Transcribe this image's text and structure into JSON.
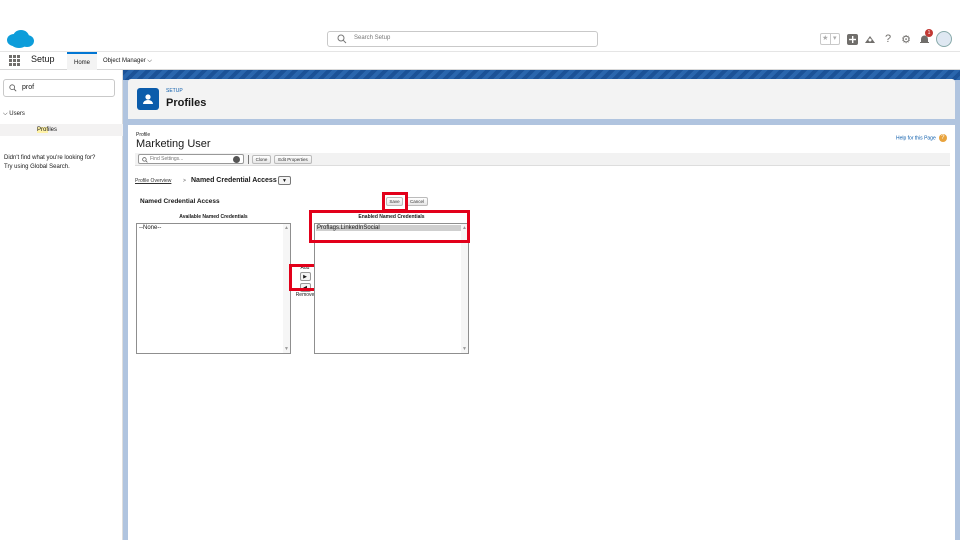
{
  "header": {
    "search_placeholder": "Search Setup",
    "notification_count": "1",
    "icons": [
      "favorites-star-icon",
      "favorites-list-icon",
      "add-icon",
      "trailhead-icon",
      "help-icon",
      "gear-icon",
      "bell-icon",
      "avatar"
    ]
  },
  "nav": {
    "app_name": "Setup",
    "tabs": [
      {
        "label": "Home"
      },
      {
        "label": "Object Manager"
      }
    ]
  },
  "sidebar": {
    "quick_find_value": "prof",
    "tree": {
      "users_label": "Users",
      "profiles_match": "Prof",
      "profiles_rest": "iles"
    },
    "no_match_line1": "Didn't find what you're looking for?",
    "no_match_line2": "Try using Global Search."
  },
  "setup_header": {
    "kicker": "SETUP",
    "title": "Profiles"
  },
  "page": {
    "type_label": "Profile",
    "title": "Marketing User",
    "help_link": "Help for this Page",
    "find_settings_placeholder": "Find Settings...",
    "clone_label": "Clone",
    "edit_properties_label": "Edit Properties",
    "profile_overview_link": "Profile Overview",
    "crumb_separator": ">",
    "current_section": "Named Credential Access",
    "section_title": "Named Credential Access",
    "save_label": "Save",
    "cancel_label": "Cancel",
    "available_header": "Available Named Credentials",
    "enabled_header": "Enabled Named Credentials",
    "available_items": [
      "--None--"
    ],
    "enabled_items": [
      "Proflags.LinkedInSocial"
    ],
    "add_label": "Add",
    "remove_label": "Remove"
  },
  "colors": {
    "brand_blue": "#0176d3",
    "highlight_red": "#e2001a",
    "setup_icon_blue": "#0b5cab"
  }
}
